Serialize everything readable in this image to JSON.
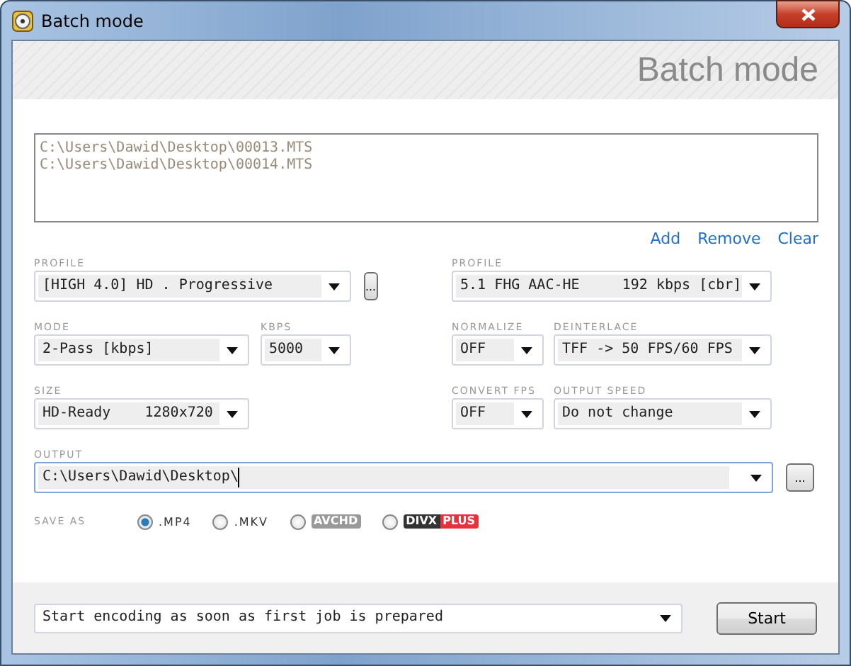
{
  "window": {
    "title": "Batch mode"
  },
  "header": {
    "title": "Batch mode"
  },
  "files": [
    "C:\\Users\\Dawid\\Desktop\\00013.MTS",
    "C:\\Users\\Dawid\\Desktop\\00014.MTS"
  ],
  "file_actions": [
    "Add",
    "Remove",
    "Clear"
  ],
  "video": [
    {
      "label": "PROFILE",
      "value": "[HIGH 4.0] HD . Progressive",
      "browse": "..."
    },
    {
      "label": "MODE",
      "value": "2-Pass [kbps]"
    },
    {
      "label": "KBPS",
      "value": "5000"
    },
    {
      "label": "SIZE",
      "value": "HD-Ready    1280x720"
    }
  ],
  "audio": [
    {
      "label": "PROFILE",
      "value": "5.1 FHG AAC-HE     192 kbps [cbr]"
    },
    {
      "label": "NORMALIZE",
      "value": "OFF"
    },
    {
      "label": "DEINTERLACE",
      "value": "TFF -> 50 FPS/60 FPS"
    },
    {
      "label": "CONVERT FPS",
      "value": "OFF"
    },
    {
      "label": "OUTPUT SPEED",
      "value": "Do not change"
    }
  ],
  "output": {
    "label": "OUTPUT",
    "value": "C:\\Users\\Dawid\\Desktop\\",
    "browse": "..."
  },
  "save_as": {
    "label": "SAVE AS",
    "options": [
      {
        "kind": "text",
        "label": ".MP4",
        "selected": true
      },
      {
        "kind": "text",
        "label": ".MKV",
        "selected": false
      },
      {
        "kind": "badge",
        "label": "AVCHD",
        "selected": false
      },
      {
        "kind": "split-badge",
        "label": "DIVX",
        "suffix": "PLUS",
        "selected": false
      }
    ]
  },
  "footer": {
    "mode": "Start encoding as soon as first job is prepared",
    "button": "Start"
  }
}
